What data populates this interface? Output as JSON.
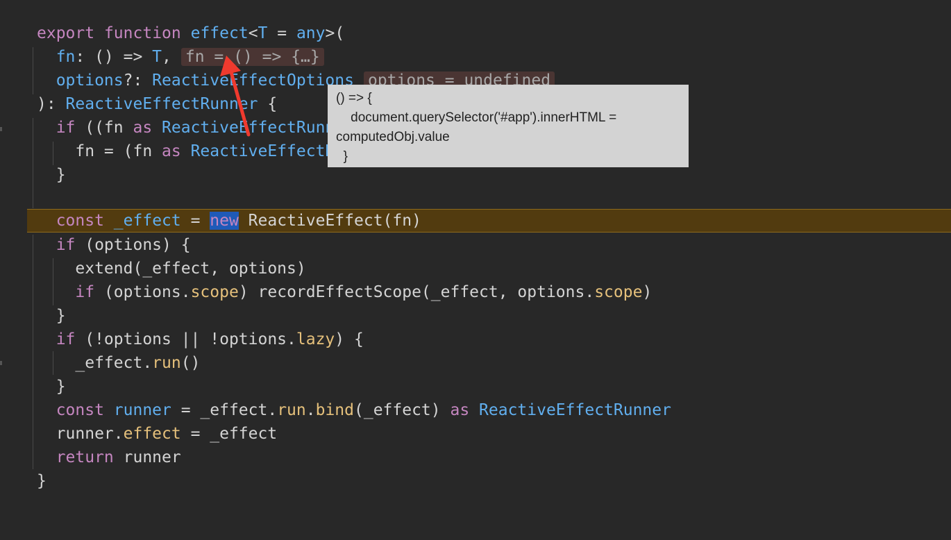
{
  "code": {
    "l1": {
      "t1": "export",
      "t2": "function",
      "t3": "effect",
      "t4": "<",
      "t5": "T",
      "t6": " = ",
      "t7": "any",
      "t8": ">("
    },
    "l2": {
      "t1": "  fn",
      "t2": ": () => ",
      "t3": "T",
      "t4": ",",
      "hint": "fn = () => {…}"
    },
    "l3": {
      "t1": "  options",
      "t2": "?: ",
      "t3": "ReactiveEffectOptions",
      "hint": "options = undefined"
    },
    "l4": {
      "t1": "): ",
      "t2": "ReactiveEffectRunner",
      "t3": " {"
    },
    "l5": {
      "t1": "  if",
      "t2": " ((fn ",
      "t3": "as",
      "t4": " ReactiveEffectRunner"
    },
    "l6": {
      "t1": "    fn = (fn ",
      "t2": "as",
      "t3": " ReactiveEffectRunner"
    },
    "l7": {
      "t1": "  }"
    },
    "l8": {
      "t1": "const",
      "t2": " _effect",
      "t3": " = ",
      "t4": "new",
      "t5": " ReactiveEffect(fn)"
    },
    "l9": {
      "t1": "  if",
      "t2": " (options) {"
    },
    "l10": {
      "t1": "    extend(_effect, options)"
    },
    "l11": {
      "t1": "    if",
      "t2": " (options.",
      "t3": "scope",
      "t4": ") recordEffectScope(_effect, options.",
      "t5": "scope",
      "t6": ")"
    },
    "l12": {
      "t1": "  }"
    },
    "l13": {
      "t1": "  if",
      "t2": " (!options || !options.",
      "t3": "lazy",
      "t4": ") {"
    },
    "l14": {
      "t1": "    _effect.",
      "t2": "run",
      "t3": "()"
    },
    "l15": {
      "t1": "  }"
    },
    "l16": {
      "t1": "  const",
      "t2": " runner",
      "t3": " = _effect.",
      "t4": "run",
      "t5": ".",
      "t6": "bind",
      "t7": "(_effect) ",
      "t8": "as",
      "t9": " ReactiveEffectRunner"
    },
    "l17": {
      "t1": "  runner.",
      "t2": "effect",
      "t3": " = _effect"
    },
    "l18": {
      "t1": "  return",
      "t2": " runner"
    },
    "l19": {
      "t1": "}"
    }
  },
  "tooltip": {
    "text": "() => {\n    document.querySelector('#app').innerHTML = computedObj.value\n  }"
  },
  "colors": {
    "background": "#282828",
    "keyword": "#c586c0",
    "function": "#61afef",
    "property": "#e5c07b",
    "current_line": "#523b0f",
    "arrow": "#f03a2e"
  }
}
